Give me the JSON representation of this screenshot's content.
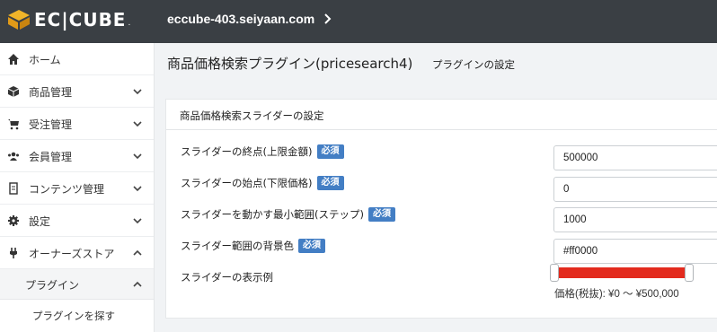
{
  "header": {
    "logo_text": "EC|CUBE",
    "logo_dot": ".",
    "site_name": "eccube-403.seiyaan.com"
  },
  "sidebar": {
    "items": [
      {
        "label": "ホーム",
        "icon": "home-icon"
      },
      {
        "label": "商品管理",
        "icon": "cube-icon"
      },
      {
        "label": "受注管理",
        "icon": "cart-icon"
      },
      {
        "label": "会員管理",
        "icon": "users-icon"
      },
      {
        "label": "コンテンツ管理",
        "icon": "document-icon"
      },
      {
        "label": "設定",
        "icon": "gear-icon"
      },
      {
        "label": "オーナーズストア",
        "icon": "plug-icon"
      }
    ],
    "sub_item": "プラグイン",
    "subsub_item": "プラグインを探す"
  },
  "main": {
    "title": "商品価格検索プラグイン(pricesearch4)",
    "subtitle": "プラグインの設定",
    "card_title": "商品価格検索スライダーの設定",
    "required_label": "必須",
    "rows": [
      {
        "label": "スライダーの終点(上限金額)",
        "value": "500000",
        "required": true
      },
      {
        "label": "スライダーの始点(下限価格)",
        "value": "0",
        "required": true
      },
      {
        "label": "スライダーを動かす最小範囲(ステップ)",
        "value": "1000",
        "required": true
      },
      {
        "label": "スライダー範囲の背景色",
        "value": "#ff0000",
        "required": true
      }
    ],
    "preview_label": "スライダーの表示例",
    "price_text": "価格(税抜): ¥0 〜 ¥500,000",
    "slider_color": "#e32b1e",
    "slider_min": 0,
    "slider_max": 500000
  },
  "colors": {
    "header_bg": "#3a3f44",
    "required_badge": "#437ec4"
  }
}
